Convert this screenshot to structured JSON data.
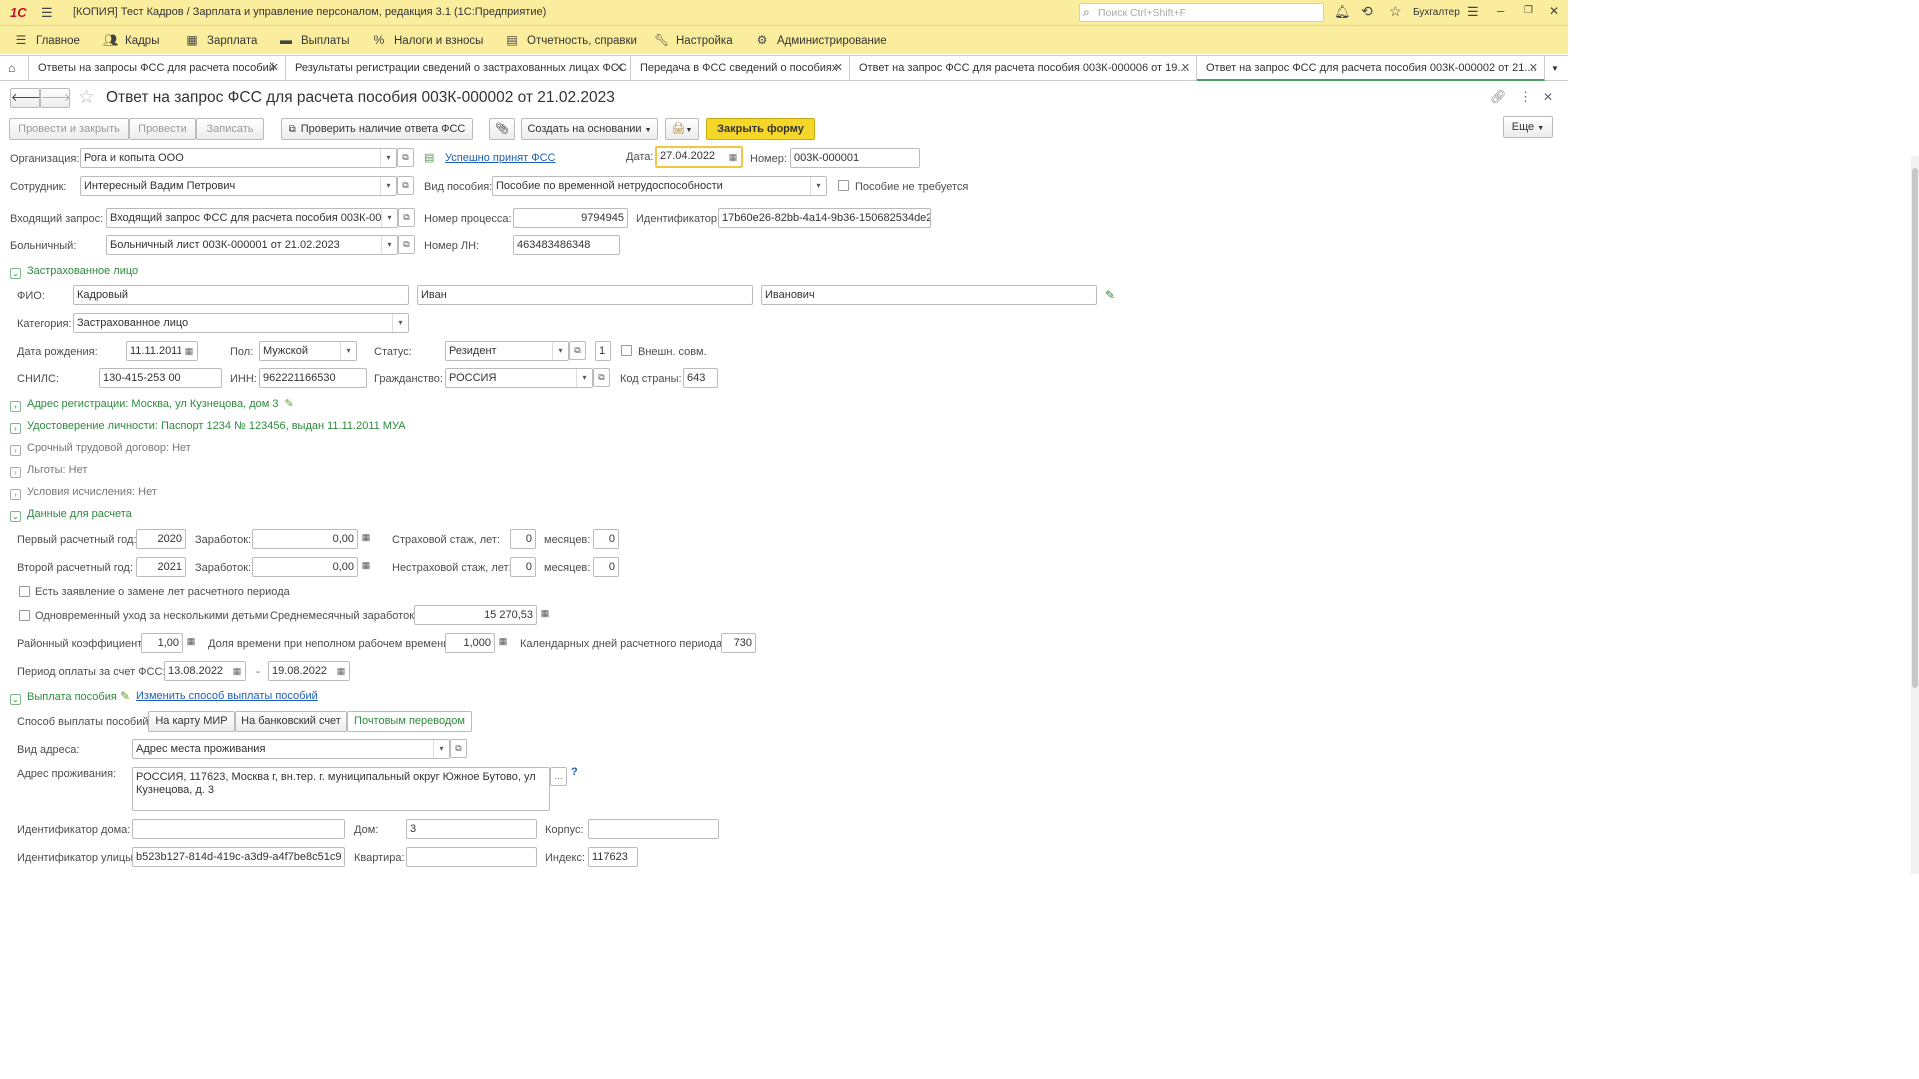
{
  "app": {
    "logo": "1С",
    "title": "[КОПИЯ] Тест Кадров / Зарплата и управление персоналом, редакция 3.1  (1С:Предприятие)",
    "search_placeholder": "Поиск Ctrl+Shift+F",
    "user": "Бухгалтер"
  },
  "menu": [
    "Главное",
    "Кадры",
    "Зарплата",
    "Выплаты",
    "Налоги и взносы",
    "Отчетность, справки",
    "Настройка",
    "Администрирование"
  ],
  "tabs": [
    "Ответы на запросы ФСС для расчета пособий",
    "Результаты регистрации сведений о застрахованных лицах ФСС",
    "Передача в ФСС сведений о пособиях",
    "Ответ на запрос ФСС для расчета пособия 003К-000006 от 19....",
    "Ответ на запрос ФСС для расчета пособия 003К-000002 от 21...."
  ],
  "doc": {
    "title": "Ответ на запрос ФСС для расчета пособия 003К-000002 от 21.02.2023"
  },
  "toolbar": {
    "post_close": "Провести и закрыть",
    "post": "Провести",
    "save": "Записать",
    "check": "Проверить наличие ответа ФСС",
    "create_based": "Создать на основании",
    "close_form": "Закрыть форму",
    "more": "Еще"
  },
  "form": {
    "org_label": "Организация:",
    "org": "Рога и копыта ООО",
    "status_link": "Успешно принят ФСС",
    "date_label": "Дата:",
    "date": "27.04.2022",
    "num_label": "Номер:",
    "num": "003К-000001",
    "emp_label": "Сотрудник:",
    "emp": "Интересный Вадим Петрович",
    "benefit_label": "Вид пособия:",
    "benefit": "Пособие по временной нетрудоспособности",
    "not_required": "Пособие не требуется",
    "req_label": "Входящий запрос:",
    "req": "Входящий запрос ФСС для расчета пособия 003К-000",
    "proc_label": "Номер процесса:",
    "proc": "9794945",
    "id_label": "Идентификатор:",
    "id": "17b60e26-82bb-4a14-9b36-150682534de2",
    "sick_label": "Больничный:",
    "sick": "Больничный лист 003К-000001 от 21.02.2023",
    "ln_label": "Номер ЛН:",
    "ln": "463483486348"
  },
  "insured": {
    "header": "Застрахованное лицо",
    "fio_label": "ФИО:",
    "last": "Кадровый",
    "first": "Иван",
    "middle": "Иванович",
    "cat_label": "Категория:",
    "cat": "Застрахованное лицо",
    "birth_label": "Дата рождения:",
    "birth": "11.11.2011",
    "sex_label": "Пол:",
    "sex": "Мужской",
    "status_label": "Статус:",
    "status": "Резидент",
    "status_code": "1",
    "ext": "Внешн. совм.",
    "snils_label": "СНИЛС:",
    "snils": "130-415-253 00",
    "inn_label": "ИНН:",
    "inn": "962221166530",
    "cit_label": "Гражданство:",
    "cit": "РОССИЯ",
    "country_label": "Код страны:",
    "country": "643"
  },
  "sections": {
    "address": "Адрес регистрации: Москва, ул Кузнецова, дом 3",
    "passport": "Удостоверение личности: Паспорт 1234 № 123456, выдан 11.11.2011 МУА",
    "contract": "Срочный трудовой договор: Нет",
    "benefits": "Льготы: Нет",
    "calc_cond": "Условия исчисления: Нет",
    "calc_data": "Данные для расчета"
  },
  "calc": {
    "y1_label": "Первый расчетный год:",
    "y1": "2020",
    "earn_label": "Заработок:",
    "e1": "0,00",
    "ins_label": "Страховой стаж, лет:",
    "ins_y": "0",
    "months_label": "месяцев:",
    "ins_m": "0",
    "y2_label": "Второй расчетный год:",
    "y2": "2021",
    "e2": "0,00",
    "nonins_label": "Нестраховой стаж, лет:",
    "non_y": "0",
    "non_m": "0",
    "replace_stmt": "Есть заявление о замене лет расчетного периода",
    "multi_care": "Одновременный уход за несколькими детьми",
    "avg_label": "Среднемесячный заработок:",
    "avg": "15 270,53",
    "coef_label": "Районный коэффициент:",
    "coef": "1,00",
    "share_label": "Доля времени при неполном рабочем времени:",
    "share": "1,000",
    "days_label": "Календарных дней расчетного периода:",
    "days": "730",
    "period_label": "Период оплаты за счет ФСС:",
    "p_from": "13.08.2022",
    "dash": "-",
    "p_to": "19.08.2022"
  },
  "payment": {
    "header": "Выплата пособия",
    "change_link": "Изменить способ выплаты пособий",
    "method_label": "Способ выплаты пособий:",
    "methods": [
      "На карту МИР",
      "На банковский счет",
      "Почтовым переводом"
    ],
    "addr_type_label": "Вид адреса:",
    "addr_type": "Адрес места проживания",
    "addr_label": "Адрес проживания:",
    "addr": "РОССИЯ, 117623, Москва г, вн.тер. г. муниципальный округ Южное Бутово, ул Кузнецова, д. 3",
    "house_id_label": "Идентификатор дома:",
    "house_id": "",
    "house_label": "Дом:",
    "house": "3",
    "corp_label": "Корпус:",
    "corp": "",
    "street_id_label": "Идентификатор улицы:",
    "street_id": "b523b127-814d-419c-a3d9-a4f7be8c51c9",
    "flat_label": "Квартира:",
    "flat": "",
    "index_label": "Индекс:",
    "index": "117623"
  }
}
